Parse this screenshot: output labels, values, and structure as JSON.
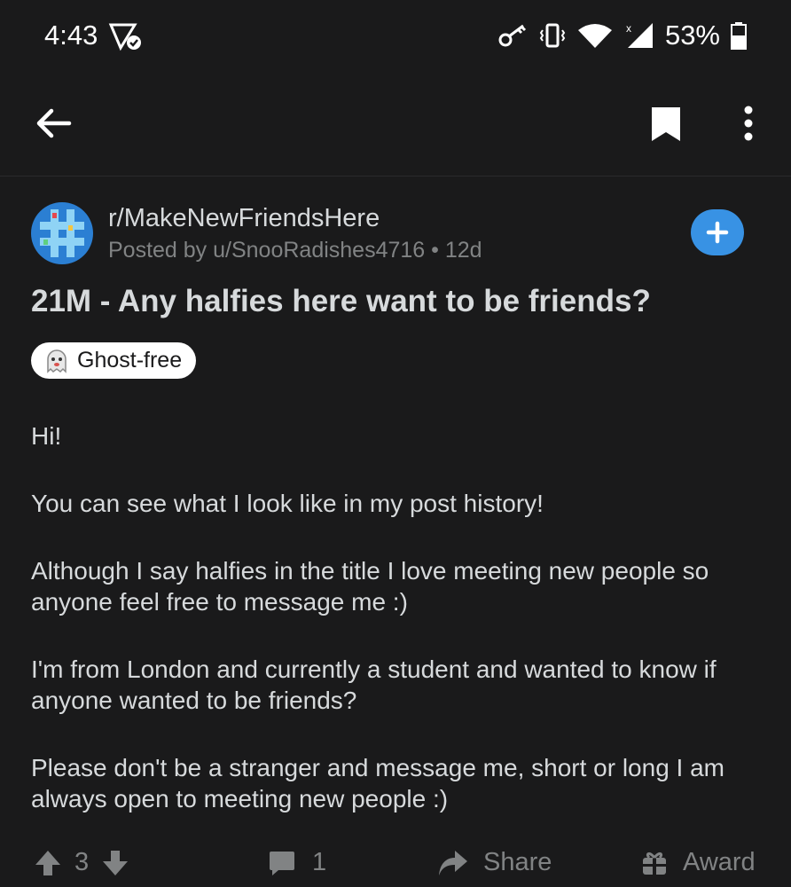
{
  "status_bar": {
    "time": "4:43",
    "battery": "53%"
  },
  "subreddit": {
    "name": "r/MakeNewFriendsHere",
    "posted_by": "Posted by u/SnooRadishes4716 • 12d"
  },
  "post": {
    "title": "21M - Any halfies here want to be friends?",
    "flair": "Ghost-free",
    "body": [
      "Hi!",
      "You can see what I look like in my post history!",
      "Although I say halfies in the title I love meeting new people so anyone feel free to message me :)",
      "I'm from London and currently a student and wanted to know if anyone wanted to be friends?",
      "Please don't be a stranger and message me, short or long I am always open to meeting new people :)"
    ]
  },
  "actions": {
    "score": "3",
    "comments": "1",
    "share_label": "Share",
    "award_label": "Award"
  },
  "colors": {
    "background": "#1a1a1b",
    "text": "#d7dadc",
    "muted": "#818384",
    "accent": "#3892e4"
  },
  "icons": [
    "back-arrow-icon",
    "bookmark-icon",
    "more-vert-icon",
    "plus-icon",
    "ghost-icon",
    "upvote-icon",
    "downvote-icon",
    "comment-icon",
    "share-icon",
    "award-icon"
  ]
}
